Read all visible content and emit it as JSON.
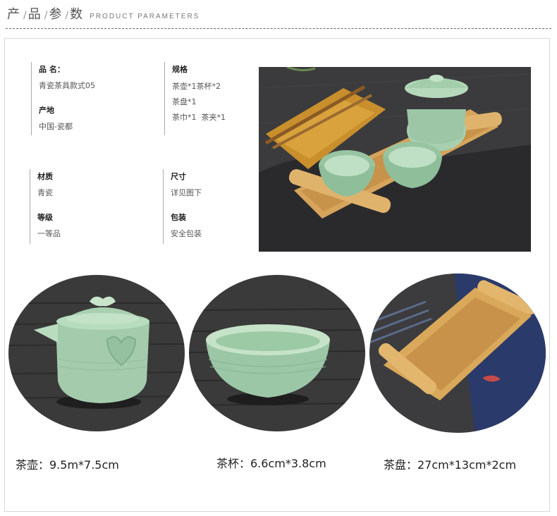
{
  "header": {
    "chars": [
      "产",
      "品",
      "参",
      "数"
    ],
    "english": "PRODUCT PARAMETERS"
  },
  "attributes": {
    "col1": [
      {
        "label": "品 名：",
        "values": [
          "青瓷茶具款式05"
        ]
      },
      {
        "label": "产地",
        "values": [
          "中国-瓷都"
        ]
      }
    ],
    "col2": [
      {
        "label": "规格",
        "values": [
          "茶壶*1茶杯*2",
          "茶盘*1",
          "茶巾*1  茶夹*1"
        ]
      }
    ],
    "col3": [
      {
        "label": "材质",
        "values": [
          "青瓷"
        ]
      },
      {
        "label": "等级",
        "values": [
          "一等品"
        ]
      }
    ],
    "col4": [
      {
        "label": "尺寸",
        "values": [
          "详见图下"
        ]
      },
      {
        "label": "包装",
        "values": [
          "安全包装"
        ]
      }
    ]
  },
  "captions": [
    "茶壶：9.5m*7.5cm",
    "茶杯：6.6cm*3.8cm",
    "茶盘：27cm*13cm*2cm"
  ],
  "colors": {
    "celadon": "#a8cfb0",
    "bamboo": "#d9a85a",
    "slate": "#3a3a3a",
    "cloth_gold": "#c98f2c",
    "navy": "#2a3a6a"
  }
}
